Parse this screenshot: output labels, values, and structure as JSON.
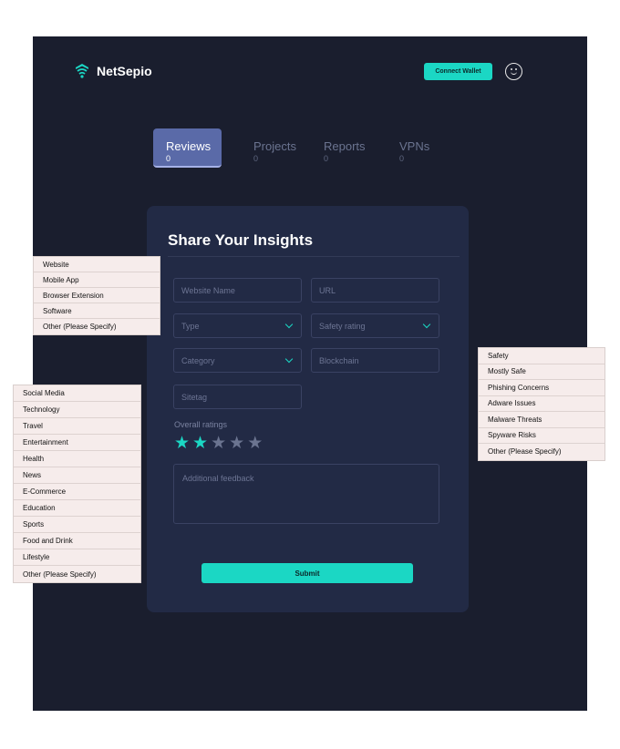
{
  "app": {
    "logo_text": "NetSepio"
  },
  "header": {
    "connect_label": "Connect Wallet"
  },
  "tabs": [
    {
      "label": "Reviews",
      "count": "0"
    },
    {
      "label": "Projects",
      "count": "0"
    },
    {
      "label": "Reports",
      "count": "0"
    },
    {
      "label": "VPNs",
      "count": "0"
    }
  ],
  "form": {
    "title": "Share Your Insights",
    "website_name_placeholder": "Website Name",
    "url_placeholder": "URL",
    "type_placeholder": "Type",
    "safety_placeholder": "Safety rating",
    "category_placeholder": "Category",
    "blockchain_placeholder": "Blockchain",
    "sitetag_placeholder": "Sitetag",
    "ratings_label": "Overall ratings",
    "rating": 2,
    "rating_max": 5,
    "feedback_placeholder": "Additional feedback",
    "submit_label": "Submit"
  },
  "type_options": [
    "Website",
    "Mobile App",
    "Browser Extension",
    "Software",
    "Other (Please Specify)"
  ],
  "category_options": [
    "Social Media",
    "Technology",
    "Travel",
    "Entertainment",
    "Health",
    "News",
    "E-Commerce",
    "Education",
    "Sports",
    "Food and Drink",
    "Lifestyle",
    "Other (Please Specify)"
  ],
  "safety_options": [
    "Safety",
    "Mostly Safe",
    "Phishing Concerns",
    "Adware Issues",
    "Malware Threats",
    "Spyware Risks",
    "Other (Please Specify)"
  ],
  "colors": {
    "accent": "#1bd7c4",
    "background": "#1a1e2e",
    "card": "#222a45",
    "active_tab": "#5a6aa8",
    "dropdown_bg": "#f6eceb"
  },
  "icons": {
    "logo": "wifi-shield-icon",
    "avatar": "smiley-icon",
    "chevron": "chevron-down-icon",
    "star": "star-icon"
  }
}
